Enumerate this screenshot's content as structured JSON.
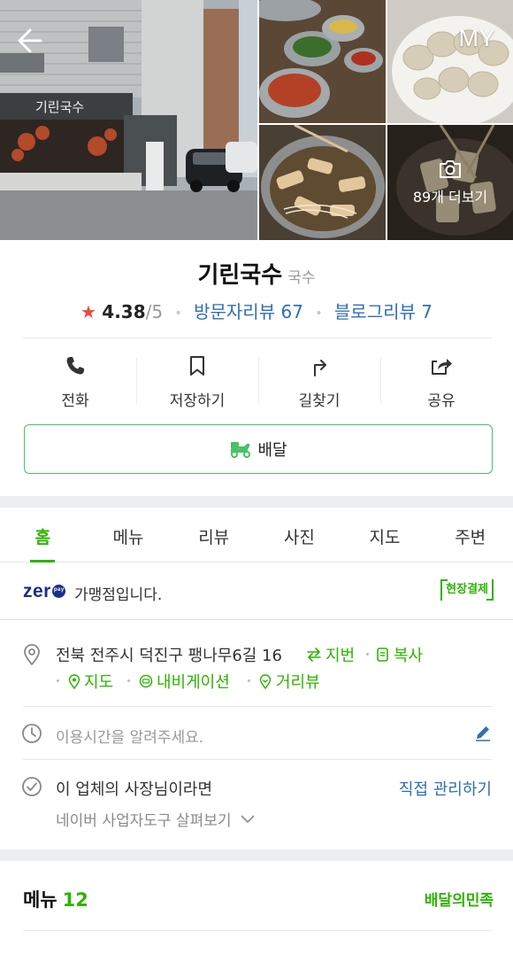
{
  "header": {
    "my_label": "MY",
    "more_photos_label": "89개 더보기",
    "storefront_sign": "기린국수"
  },
  "place": {
    "name": "기린국수",
    "category": "국수",
    "rating_star": "★",
    "rating": "4.38",
    "rating_scale": "/5",
    "visitor_reviews": "방문자리뷰 67",
    "blog_reviews": "블로그리뷰 7"
  },
  "actions": [
    {
      "label": "전화",
      "icon": "phone-icon"
    },
    {
      "label": "저장하기",
      "icon": "bookmark-icon"
    },
    {
      "label": "길찾기",
      "icon": "directions-icon"
    },
    {
      "label": "공유",
      "icon": "share-icon"
    }
  ],
  "delivery": {
    "label": "배달",
    "icon": "delivery-scooter-icon"
  },
  "tabs": [
    {
      "label": "홈",
      "active": true
    },
    {
      "label": "메뉴"
    },
    {
      "label": "리뷰"
    },
    {
      "label": "사진"
    },
    {
      "label": "지도"
    },
    {
      "label": "주변"
    }
  ],
  "zeropay": {
    "logo_text": "zer",
    "text": "가맹점입니다.",
    "badge": "현장결제"
  },
  "address": {
    "text": "전북 전주시 덕진구 팽나무6길 16",
    "jibun": "지번",
    "copy": "복사",
    "map": "지도",
    "navigation": "내비게이션",
    "street_view": "거리뷰"
  },
  "hours": {
    "placeholder": "이용시간을 알려주세요."
  },
  "owner": {
    "text": "이 업체의 사장님이라면",
    "link": "직접 관리하기",
    "sub": "네이버 사업자도구 살펴보기"
  },
  "menu_section": {
    "title": "메뉴",
    "count": "12",
    "source": "배달의민족"
  },
  "colors": {
    "accent_green": "#2db400",
    "link_blue": "#2f6fb5",
    "star_red": "#f0473e",
    "zeropay_navy": "#1b2f8a"
  }
}
